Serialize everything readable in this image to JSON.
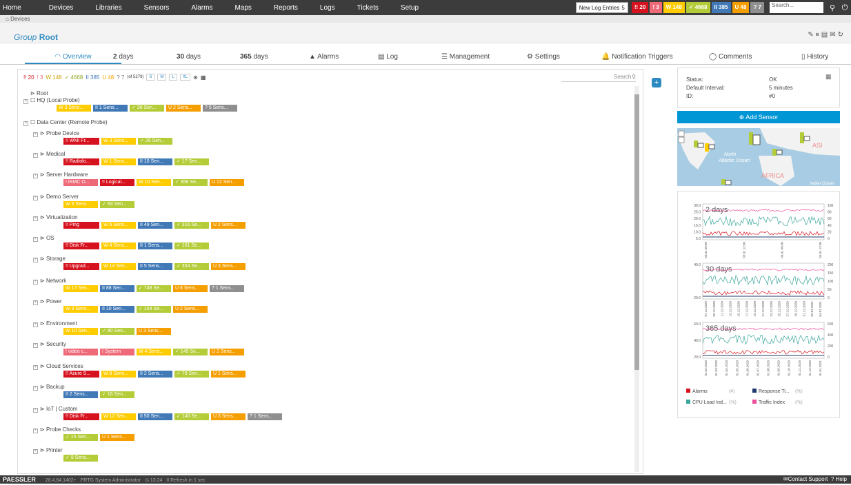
{
  "topnav": {
    "items": [
      "Home",
      "Devices",
      "Libraries",
      "Sensors",
      "Alarms",
      "Maps",
      "Reports",
      "Logs",
      "Tickets",
      "Setup"
    ]
  },
  "topbar": {
    "new_log_label": "New Log Entries",
    "new_log_count": "5",
    "counts": [
      {
        "text": "!! 20",
        "color": "#d7121f"
      },
      {
        "text": "! 3",
        "color": "#ee6a79"
      },
      {
        "text": "W 148",
        "color": "#ffcc00"
      },
      {
        "text": "✓ 4668",
        "color": "#b4cc38"
      },
      {
        "text": "II 385",
        "color": "#4179b7"
      },
      {
        "text": "U 48",
        "color": "#f59e00"
      },
      {
        "text": "? 7",
        "color": "#8f8f8f"
      }
    ],
    "search_placeholder": "Search..."
  },
  "breadcrumb": "Devices",
  "title": {
    "prefix": "Group",
    "name": "Root"
  },
  "tabs": [
    {
      "num": "",
      "label": "Overview"
    },
    {
      "num": "2",
      "label": "days"
    },
    {
      "num": "30",
      "label": "days"
    },
    {
      "num": "365",
      "label": "days"
    },
    {
      "num": "",
      "label": "Alarms"
    },
    {
      "num": "",
      "label": "Log"
    },
    {
      "num": "",
      "label": "Management"
    },
    {
      "num": "",
      "label": "Settings"
    },
    {
      "num": "",
      "label": "Notification Triggers"
    },
    {
      "num": "",
      "label": "Comments"
    },
    {
      "num": "",
      "label": "History"
    }
  ],
  "filter": {
    "items": [
      "!! 20",
      "! 3",
      "W 148",
      "✓ 4668",
      "II 385",
      "U 48",
      "? 7"
    ],
    "of_text": "(of 5279)",
    "sizes": [
      "S",
      "M",
      "L",
      "XL"
    ],
    "search_placeholder": "Search..."
  },
  "tree": [
    {
      "label": "Root",
      "indent": 0,
      "tags": []
    },
    {
      "label": "HQ (Local Probe)",
      "indent": 0,
      "tags": [
        [
          "W 3 Sens...",
          "yel"
        ],
        [
          "II 1 Sens...",
          "blu"
        ],
        [
          "✓ 36 Sen...",
          "grn"
        ],
        [
          "U 2 Sens...",
          "org"
        ],
        [
          "? 5 Sens...",
          "gry"
        ]
      ]
    },
    {
      "label": "Data Center (Remote Probe)",
      "indent": 0,
      "tags": []
    },
    {
      "label": "Probe Device",
      "indent": 1,
      "tags": [
        [
          "!! WMI Fr...",
          "red"
        ],
        [
          "W 3 Sens...",
          "yel"
        ],
        [
          "✓ 26 Sen...",
          "grn"
        ]
      ]
    },
    {
      "label": "Medical",
      "indent": 1,
      "tags": [
        [
          "!! Radiolo...",
          "red"
        ],
        [
          "W 1 Sens...",
          "yel"
        ],
        [
          "II 10 Sen...",
          "blu"
        ],
        [
          "✓ 17 Sen...",
          "grn"
        ]
      ]
    },
    {
      "label": "Server Hardware",
      "indent": 1,
      "tags": [
        [
          "! iRMC O...",
          "lred"
        ],
        [
          "!! Logical...",
          "red"
        ],
        [
          "W 10 Sen...",
          "yel"
        ],
        [
          "✓ 356 Se...",
          "grn"
        ],
        [
          "U 12 Sen...",
          "org"
        ]
      ]
    },
    {
      "label": "Demo Server",
      "indent": 1,
      "tags": [
        [
          "W 3 Sens...",
          "yel"
        ],
        [
          "✓ 93 Sen...",
          "grn"
        ]
      ]
    },
    {
      "label": "Virtualization",
      "indent": 1,
      "tags": [
        [
          "!! Ping",
          "red"
        ],
        [
          "W 6 Sens...",
          "yel"
        ],
        [
          "II 49 Sen...",
          "blu"
        ],
        [
          "✓ 316 Se...",
          "grn"
        ],
        [
          "U 2 Sens...",
          "org"
        ]
      ]
    },
    {
      "label": "OS",
      "indent": 1,
      "tags": [
        [
          "!! Disk Fr...",
          "red"
        ],
        [
          "W 4 Sens...",
          "yel"
        ],
        [
          "II 1 Sens...",
          "blu"
        ],
        [
          "✓ 161 Se...",
          "grn"
        ]
      ]
    },
    {
      "label": "Storage",
      "indent": 1,
      "tags": [
        [
          "!! Upgrad...",
          "red"
        ],
        [
          "W 14 Sen...",
          "yel"
        ],
        [
          "II 5 Sens...",
          "blu"
        ],
        [
          "✓ 354 Se...",
          "grn"
        ],
        [
          "U 3 Sens...",
          "org"
        ]
      ]
    },
    {
      "label": "Network",
      "indent": 1,
      "tags": [
        [
          "W 17 Sen...",
          "yel"
        ],
        [
          "II 88 Sen...",
          "blu"
        ],
        [
          "✓ 748 Se...",
          "grn"
        ],
        [
          "U 8 Sens...",
          "org"
        ],
        [
          "? 1 Sens...",
          "gry"
        ]
      ]
    },
    {
      "label": "Power",
      "indent": 1,
      "tags": [
        [
          "W 3 Sens...",
          "yel"
        ],
        [
          "II 10 Sen...",
          "blu"
        ],
        [
          "✓ 164 Se...",
          "grn"
        ],
        [
          "U 2 Sens...",
          "org"
        ]
      ]
    },
    {
      "label": "Environment",
      "indent": 1,
      "tags": [
        [
          "W 10 Sen...",
          "yel"
        ],
        [
          "✓ 80 Sen...",
          "grn"
        ],
        [
          "U 3 Sens...",
          "org"
        ]
      ]
    },
    {
      "label": "Security",
      "indent": 1,
      "tags": [
        [
          "! video c...",
          "lred"
        ],
        [
          "! System",
          "lred"
        ],
        [
          "W 4 Sens...",
          "yel"
        ],
        [
          "✓ 149 Se...",
          "grn"
        ],
        [
          "U 2 Sens...",
          "org"
        ]
      ]
    },
    {
      "label": "Cloud Services",
      "indent": 1,
      "tags": [
        [
          "!! Azure S...",
          "red"
        ],
        [
          "W 8 Sens...",
          "yel"
        ],
        [
          "II 2 Sens...",
          "blu"
        ],
        [
          "✓ 78 Sen...",
          "grn"
        ],
        [
          "U 1 Sens...",
          "org"
        ]
      ]
    },
    {
      "label": "Backup",
      "indent": 1,
      "tags": [
        [
          "II 2 Sens...",
          "blu"
        ],
        [
          "✓ 16 Sen...",
          "grn"
        ]
      ]
    },
    {
      "label": "IoT | Custom",
      "indent": 1,
      "tags": [
        [
          "!! Disk Fr...",
          "red"
        ],
        [
          "W 12 Sen...",
          "yel"
        ],
        [
          "II 50 Sen...",
          "blu"
        ],
        [
          "✓ 140 Se...",
          "grn"
        ],
        [
          "U 3 Sens...",
          "org"
        ],
        [
          "? 1 Sens...",
          "gry"
        ]
      ]
    },
    {
      "label": "Probe Checks",
      "indent": 1,
      "tags": [
        [
          "✓ 15 Sen...",
          "grn"
        ],
        [
          "U 1 Sens...",
          "org"
        ]
      ]
    },
    {
      "label": "Printer",
      "indent": 1,
      "tags": [
        [
          "✓ 9 Sens...",
          "grn"
        ]
      ]
    }
  ],
  "info": {
    "status_label": "Status:",
    "status": "OK",
    "interval_label": "Default Interval:",
    "interval": "5 minutes",
    "id_label": "ID:",
    "id": "#0"
  },
  "add_sensor": "Add Sensor",
  "map": {
    "labels": [
      "North",
      "Atlantic Ocean",
      "AFRICA",
      "ASI",
      "Indian Ocean"
    ]
  },
  "charts": [
    {
      "title": "2 days",
      "left_ticks": [
        "30.0",
        "25.0",
        "20.0",
        "15.0",
        "10.0",
        "5.0"
      ],
      "right_ticks": [
        "100",
        "80",
        "60",
        "40",
        "20",
        "0"
      ],
      "xlabels": [
        "03.01 00:00",
        "03.01 12:00",
        "04.01 00:00",
        "04.01 12:00"
      ]
    },
    {
      "title": "30 days",
      "left_ticks": [
        "40.0",
        "20.0"
      ],
      "right_ticks": [
        "200",
        "150",
        "100",
        "50",
        "0"
      ],
      "xlabels": [
        "07.12.2020",
        "09.12.2020",
        "11.12.2020",
        "13.12.2020",
        "15.12.2020",
        "17.12.2020",
        "19.12.2020",
        "21.12.2020",
        "23.12.2020",
        "25.12.2020",
        "27.12.2020",
        "29.12.2020",
        "31.12.2020",
        "02.01.2021",
        "04.01.2021"
      ]
    },
    {
      "title": "365 days",
      "left_ticks": [
        "60.0",
        "40.0",
        "20.0"
      ],
      "right_ticks": [
        "600",
        "400",
        "200",
        "0"
      ],
      "xlabels": [
        "01.02.2020",
        "01.03.2020",
        "01.04.2020",
        "01.05.2020",
        "01.06.2020",
        "01.07.2020",
        "01.08.2020",
        "01.09.2020",
        "01.10.2020",
        "01.11.2020",
        "01.12.2020",
        "01.01.2021"
      ]
    }
  ],
  "legend": [
    {
      "name": "Alarms",
      "unit": "(#)",
      "color": "#d7121f"
    },
    {
      "name": "Response Ti...",
      "unit": "(%)",
      "color": "#1f3a6e"
    },
    {
      "name": "CPU Load Ind...",
      "unit": "(%)",
      "color": "#3aa59b"
    },
    {
      "name": "Traffic Index",
      "unit": "(%)",
      "color": "#ee4f9c"
    }
  ],
  "footer": {
    "logo": "PAESSLER",
    "version": "20.4.64.1402+",
    "user": "PRTG System Administrator",
    "time": "13:24",
    "refresh": "Refresh in 1 sec",
    "contact": "Contact Support",
    "help": "Help"
  }
}
